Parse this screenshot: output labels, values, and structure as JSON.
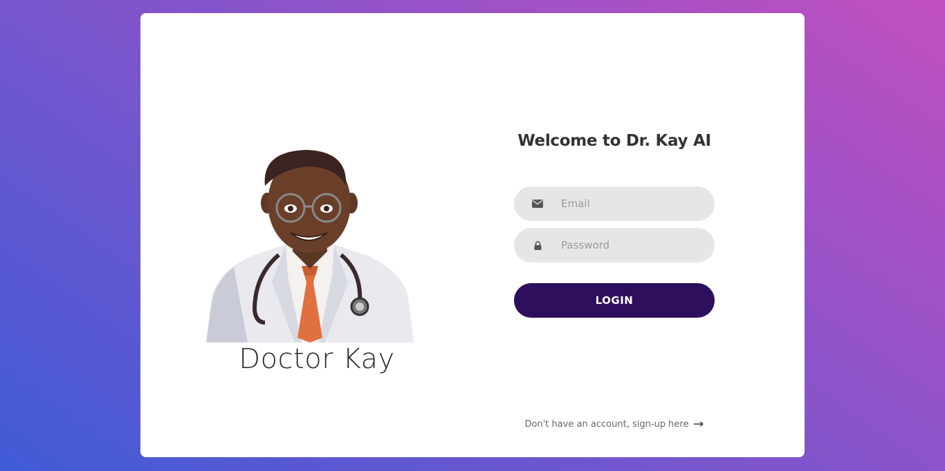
{
  "brand": {
    "doctor_name": "Doctor Kay",
    "welcome_title": "Welcome to Dr. Kay AI"
  },
  "form": {
    "email": {
      "placeholder": "Email",
      "value": "",
      "icon": "envelope-icon"
    },
    "password": {
      "placeholder": "Password",
      "value": "",
      "icon": "lock-icon"
    },
    "login_label": "LOGIN"
  },
  "signup": {
    "text": "Don't have an account, sign-up here",
    "icon": "arrow-right-icon"
  },
  "colors": {
    "gradient_start": "#3f5bd6",
    "gradient_end": "#c14fc0",
    "login_button": "#2e0f5e",
    "field_background": "#e6e6e6"
  }
}
